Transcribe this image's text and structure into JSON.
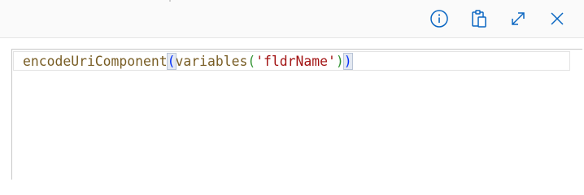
{
  "toolbar": {
    "buttons": [
      {
        "name": "info",
        "icon": "info-icon"
      },
      {
        "name": "copy",
        "icon": "clipboard-icon"
      },
      {
        "name": "expand",
        "icon": "expand-icon"
      },
      {
        "name": "close",
        "icon": "close-icon"
      }
    ],
    "accent_color": "#0a66c2"
  },
  "editor": {
    "tokens": {
      "fn1": "encodeUriComponent",
      "open1": "(",
      "fn2": "variables",
      "open2": "(",
      "str": "'fldrName'",
      "close2": ")",
      "close1": ")"
    }
  }
}
